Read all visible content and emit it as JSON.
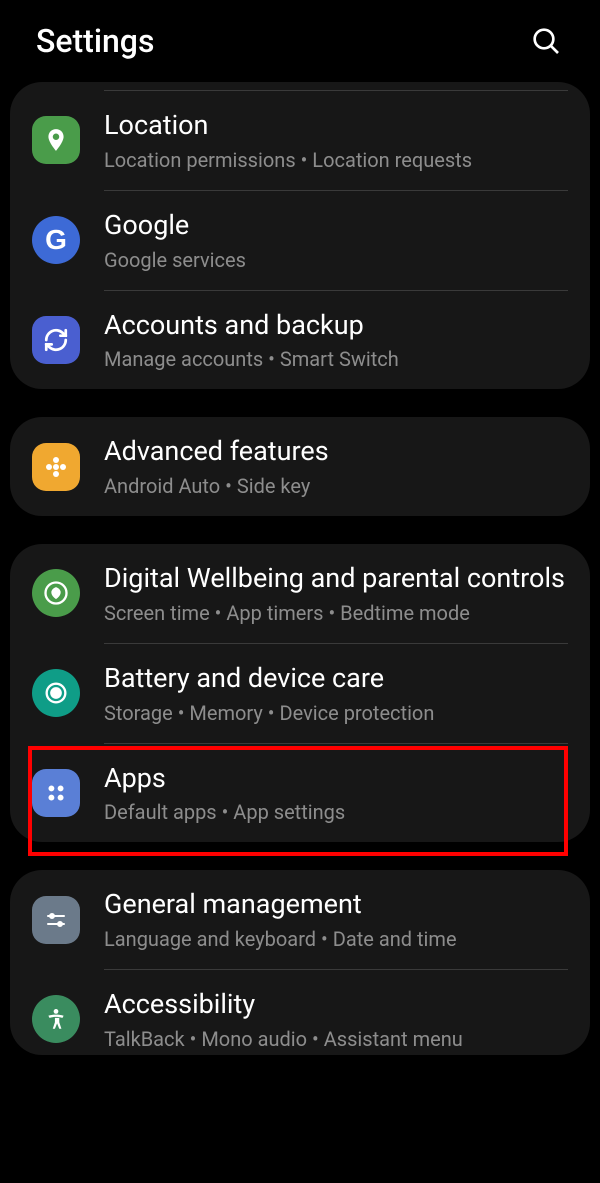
{
  "header": {
    "title": "Settings"
  },
  "groups": [
    {
      "items": [
        {
          "id": "location",
          "title": "Location",
          "subtitle": "Location permissions  •  Location requests",
          "iconBg": "#4a9c4a"
        },
        {
          "id": "google",
          "title": "Google",
          "subtitle": "Google services",
          "iconBg": "#3d6ad6"
        },
        {
          "id": "accounts-backup",
          "title": "Accounts and backup",
          "subtitle": "Manage accounts  •  Smart Switch",
          "iconBg": "#4a5fd0"
        }
      ]
    },
    {
      "items": [
        {
          "id": "advanced-features",
          "title": "Advanced features",
          "subtitle": "Android Auto  •  Side key",
          "iconBg": "#f0a830"
        }
      ]
    },
    {
      "items": [
        {
          "id": "digital-wellbeing",
          "title": "Digital Wellbeing and parental controls",
          "subtitle": "Screen time  •  App timers  •  Bedtime mode",
          "iconBg": "#4a9c4a"
        },
        {
          "id": "battery-device-care",
          "title": "Battery and device care",
          "subtitle": "Storage  •  Memory  •  Device protection",
          "iconBg": "#0f9d87"
        },
        {
          "id": "apps",
          "title": "Apps",
          "subtitle": "Default apps  •  App settings",
          "iconBg": "#5a7fd6"
        }
      ]
    },
    {
      "items": [
        {
          "id": "general-management",
          "title": "General management",
          "subtitle": "Language and keyboard  •  Date and time",
          "iconBg": "#6b7a8a"
        },
        {
          "id": "accessibility",
          "title": "Accessibility",
          "subtitle": "TalkBack  •  Mono audio  •  Assistant menu",
          "iconBg": "#3a8c5f"
        }
      ]
    }
  ]
}
